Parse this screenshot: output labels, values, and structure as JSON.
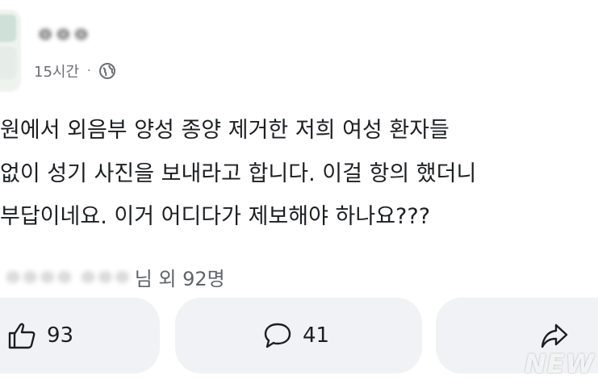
{
  "post": {
    "author": "ㅇㅇㅇ",
    "timestamp": "15시간",
    "separator": "·",
    "body_lines": [
      "원에서 외음부 양성 종양 제거한 저희 여성 환자들",
      "없이 성기 사진을 보내라고 합니다. 이걸 항의 했더니",
      "부답이네요. 이거 어디다가 제보해야 하나요???"
    ]
  },
  "reactions": {
    "reactors_blurred": "ㅇㅇㅇㅇ ㅇㅇㅇ",
    "reactors_suffix": "님 외 92명"
  },
  "actions": {
    "like_count": "93",
    "comment_count": "41"
  },
  "watermark": "NEW",
  "icons": {
    "globe": "globe-icon",
    "like": "thumbs-up-icon",
    "comment": "comment-icon",
    "share": "share-icon"
  },
  "colors": {
    "button_bg": "#f0f2f5",
    "meta_text": "#6b6e73"
  }
}
